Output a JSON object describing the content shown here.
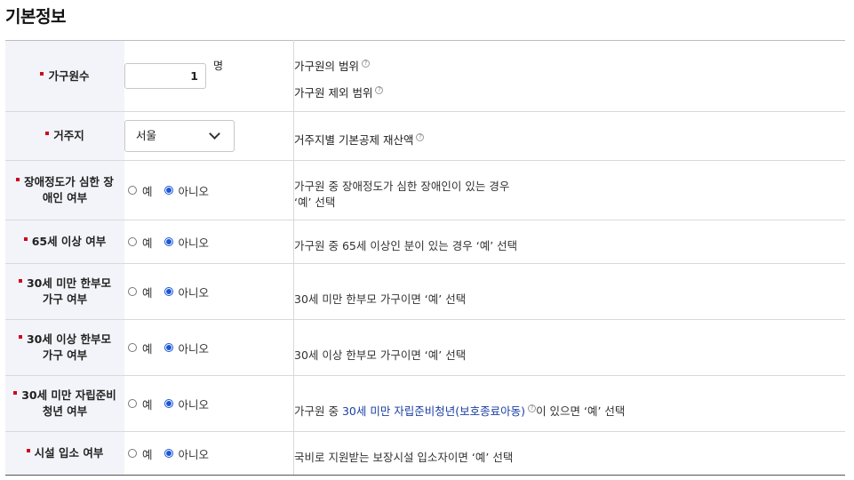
{
  "section_title": "기본정보",
  "rows": {
    "household_size": {
      "label": "가구원수",
      "value": "1",
      "unit": "명",
      "links": [
        "가구원의 범위",
        "가구원 제외 범위"
      ]
    },
    "residence": {
      "label": "거주지",
      "selected": "서울",
      "links": [
        "거주지별 기본공제 재산액"
      ]
    },
    "severe_disability": {
      "label_line1": "장애정도가 심한 장",
      "label_line2": "애인 여부",
      "yes": "예",
      "no": "아니오",
      "selected": "no",
      "desc_line1": "가구원 중 장애정도가 심한 장애인이 있는 경우",
      "desc_line2": "‘예’ 선택"
    },
    "age65": {
      "label": "65세 이상 여부",
      "yes": "예",
      "no": "아니오",
      "selected": "no",
      "desc": "가구원 중 65세 이상인 분이 있는 경우 ‘예’ 선택"
    },
    "single_parent_under30": {
      "label_line1": "30세 미만 한부모",
      "label_line2": "가구 여부",
      "yes": "예",
      "no": "아니오",
      "selected": "no",
      "desc": "30세 미만 한부모 가구이면 ‘예’ 선택"
    },
    "single_parent_over30": {
      "label_line1": "30세 이상 한부모",
      "label_line2": "가구 여부",
      "yes": "예",
      "no": "아니오",
      "selected": "no",
      "desc": "30세 이상 한부모 가구이면 ‘예’ 선택"
    },
    "youth_independence": {
      "label_line1": "30세 미만 자립준비",
      "label_line2": "청년 여부",
      "yes": "예",
      "no": "아니오",
      "selected": "no",
      "desc_prefix": "가구원 중 ",
      "desc_link": "30세 미만 자립준비청년(보호종료아동)",
      "desc_suffix": "이 있으면 ‘예’ 선택"
    },
    "facility": {
      "label": "시설 입소 여부",
      "yes": "예",
      "no": "아니오",
      "selected": "no",
      "desc": "국비로 지원받는 보장시설 입소자이면 ‘예’ 선택"
    }
  },
  "colors": {
    "required_marker": "#d0021b",
    "radio_active": "#1a56d6",
    "label_bg": "#f3f4f9"
  }
}
